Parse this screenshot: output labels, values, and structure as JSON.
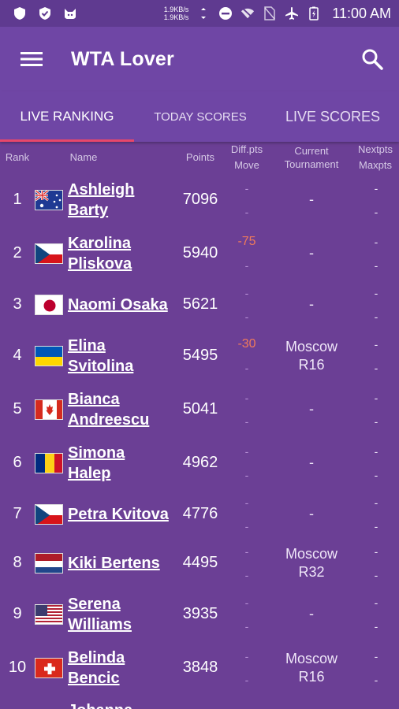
{
  "status_bar": {
    "speed_up": "1.9KB/s",
    "speed_down": "1.9KB/s",
    "time": "11:00 AM"
  },
  "app_bar": {
    "title": "WTA Lover",
    "menu_icon": "hamburger-menu-icon",
    "search_icon": "search-icon"
  },
  "tabs": [
    {
      "label": "LIVE RANKING",
      "active": true
    },
    {
      "label": "TODAY SCORES",
      "active": false
    },
    {
      "label": "LIVE SCORES",
      "active": false
    }
  ],
  "columns": {
    "rank": "Rank",
    "name": "Name",
    "points": "Points",
    "diff": "Diff.pts",
    "move": "Move",
    "current": "Current",
    "tournament": "Tournament",
    "nextpts": "Nextpts",
    "maxpts": "Maxpts"
  },
  "players": [
    {
      "rank": "1",
      "first": "Ashleigh",
      "last": "Barty",
      "points": "7096",
      "diff": "-",
      "move": "-",
      "tournament": "-",
      "round": "",
      "nextpts": "-",
      "maxpts": "-",
      "flag": "australia"
    },
    {
      "rank": "2",
      "first": "Karolina",
      "last": "Pliskova",
      "points": "5940",
      "diff": "-75",
      "move": "-",
      "tournament": "-",
      "round": "",
      "nextpts": "-",
      "maxpts": "-",
      "flag": "czech"
    },
    {
      "rank": "3",
      "first": "Naomi Osaka",
      "last": "",
      "points": "5621",
      "diff": "-",
      "move": "-",
      "tournament": "-",
      "round": "",
      "nextpts": "-",
      "maxpts": "-",
      "flag": "japan"
    },
    {
      "rank": "4",
      "first": "Elina",
      "last": "Svitolina",
      "points": "5495",
      "diff": "-30",
      "move": "-",
      "tournament": "Moscow",
      "round": "R16",
      "nextpts": "-",
      "maxpts": "-",
      "flag": "ukraine"
    },
    {
      "rank": "5",
      "first": "Bianca",
      "last": "Andreescu",
      "points": "5041",
      "diff": "-",
      "move": "-",
      "tournament": "-",
      "round": "",
      "nextpts": "-",
      "maxpts": "-",
      "flag": "canada"
    },
    {
      "rank": "6",
      "first": "Simona",
      "last": "Halep",
      "points": "4962",
      "diff": "-",
      "move": "-",
      "tournament": "-",
      "round": "",
      "nextpts": "-",
      "maxpts": "-",
      "flag": "romania"
    },
    {
      "rank": "7",
      "first": "Petra Kvitova",
      "last": "",
      "points": "4776",
      "diff": "-",
      "move": "-",
      "tournament": "-",
      "round": "",
      "nextpts": "-",
      "maxpts": "-",
      "flag": "czech"
    },
    {
      "rank": "8",
      "first": "Kiki Bertens",
      "last": "",
      "points": "4495",
      "diff": "-",
      "move": "-",
      "tournament": "Moscow",
      "round": "R32",
      "nextpts": "-",
      "maxpts": "-",
      "flag": "netherlands"
    },
    {
      "rank": "9",
      "first": "Serena",
      "last": "Williams",
      "points": "3935",
      "diff": "-",
      "move": "-",
      "tournament": "-",
      "round": "",
      "nextpts": "-",
      "maxpts": "-",
      "flag": "usa"
    },
    {
      "rank": "10",
      "first": "Belinda",
      "last": "Bencic",
      "points": "3848",
      "diff": "-",
      "move": "-",
      "tournament": "Moscow",
      "round": "R16",
      "nextpts": "-",
      "maxpts": "-",
      "flag": "switzerland"
    },
    {
      "rank": "",
      "first": "Johanna",
      "last": "",
      "points": "",
      "diff": "",
      "move": "",
      "tournament": "",
      "round": "",
      "nextpts": "",
      "maxpts": "",
      "flag": ""
    }
  ]
}
